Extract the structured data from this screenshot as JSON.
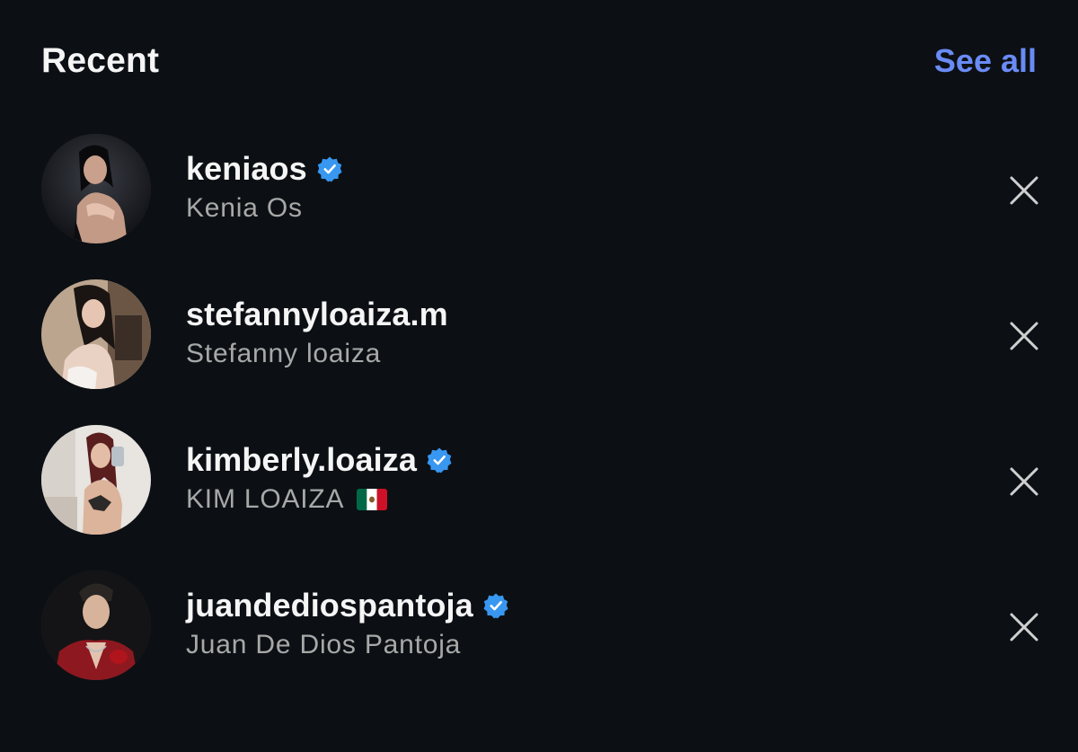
{
  "header": {
    "title": "Recent",
    "see_all_label": "See all"
  },
  "colors": {
    "background": "#0c1014",
    "primary_text": "#f5f5f5",
    "secondary_text": "#a8a8a8",
    "link": "#6a8bf5",
    "verified_badge": "#3897f0"
  },
  "recent": [
    {
      "username": "keniaos",
      "full_name": "Kenia Os",
      "verified": true,
      "avatar": "profile-photo",
      "remove_icon": "close-icon"
    },
    {
      "username": "stefannyloaiza.m",
      "full_name": "Stefanny loaiza",
      "verified": false,
      "avatar": "profile-photo",
      "remove_icon": "close-icon"
    },
    {
      "username": "kimberly.loaiza",
      "full_name": "KIM LOAIZA",
      "full_name_emoji": "mexico-flag",
      "verified": true,
      "avatar": "profile-photo",
      "remove_icon": "close-icon"
    },
    {
      "username": "juandediospantoja",
      "full_name": "Juan De Dios Pantoja",
      "verified": true,
      "avatar": "profile-photo",
      "remove_icon": "close-icon"
    }
  ]
}
